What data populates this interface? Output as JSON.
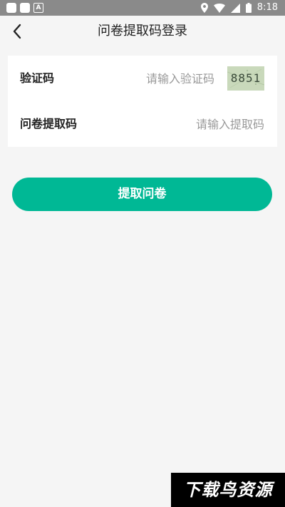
{
  "status_bar": {
    "time": "8:18",
    "left_icons": [
      "app-square-icon",
      "app-square-icon",
      "a-badge-icon"
    ],
    "left_badge": "A",
    "right_icons": [
      "location-icon",
      "wifi-icon",
      "signal-icon",
      "battery-icon"
    ]
  },
  "header": {
    "title": "问卷提取码登录",
    "back_icon": "chevron-left-icon"
  },
  "form": {
    "captcha_row": {
      "label": "验证码",
      "placeholder": "请输入验证码",
      "captcha_text": "8851"
    },
    "code_row": {
      "label": "问卷提取码",
      "placeholder": "请输入提取码"
    }
  },
  "submit": {
    "label": "提取问卷"
  },
  "watermark": {
    "text": "下载鸟资源"
  },
  "colors": {
    "status_bar": "#8a8a8a",
    "background": "#f5f5f5",
    "accent": "#00b895",
    "captcha_bg": "#c9d9bb"
  }
}
